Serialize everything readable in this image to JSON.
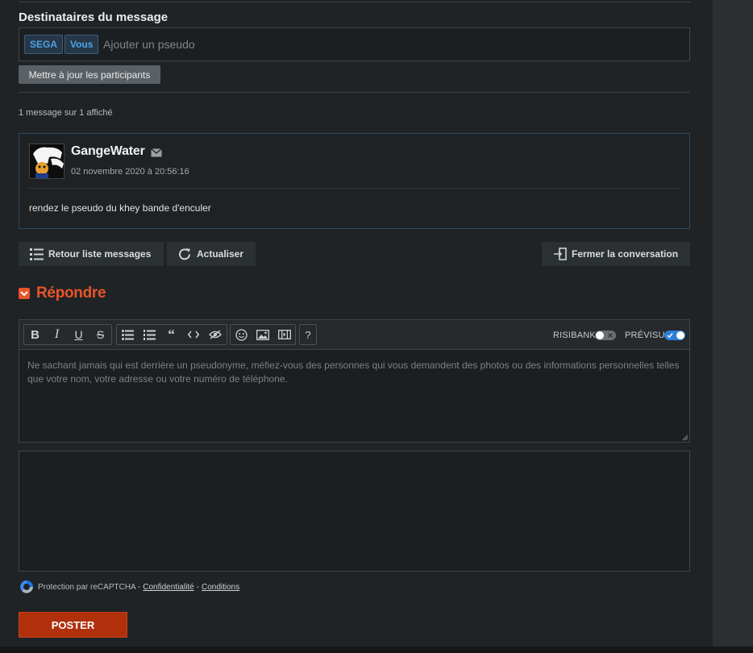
{
  "recipients": {
    "title": "Destinataires du message",
    "tags": [
      "SEGA",
      "Vous"
    ],
    "input_placeholder": "Ajouter un pseudo",
    "update_button": "Mettre à jour les participants"
  },
  "message_count": "1 message sur 1 affiché",
  "message": {
    "author": "GangeWater",
    "date": "02 novembre 2020 à 20:56:16",
    "body": "rendez le pseudo du khey bande d'enculer",
    "icons": [
      "avatar-image",
      "mail-icon"
    ]
  },
  "actions": {
    "back": "Retour liste messages",
    "refresh": "Actualiser",
    "close": "Fermer la conversation"
  },
  "reply": {
    "title": "Répondre",
    "toolbar": {
      "formatting": [
        "bold-icon",
        "italic-icon",
        "underline-icon",
        "strikethrough-icon"
      ],
      "blocks": [
        "bullet-list-icon",
        "numbered-list-icon",
        "quote-icon",
        "code-icon",
        "spoiler-icon"
      ],
      "media": [
        "smiley-icon",
        "image-icon",
        "video-icon"
      ],
      "help": "?"
    },
    "toggles": [
      {
        "label": "RISIBANK",
        "on": false
      },
      {
        "label": "PRÉVISU",
        "on": true
      }
    ],
    "placeholder": "Ne sachant jamais qui est derrière un pseudonyme, méfiez-vous des personnes qui vous demandent des photos ou des informations personnelles telles que votre nom, votre adresse ou votre numéro de téléphone."
  },
  "captcha": {
    "text": "Protection par reCAPTCHA -",
    "privacy": "Confidentialité",
    "sep": "-",
    "terms": "Conditions"
  },
  "submit": "POSTER",
  "colors": {
    "accent": "#e8542a",
    "submit_bg": "#b0300c",
    "tag_text": "#4fa3e8",
    "card_border": "#2c4763",
    "toggle_on": "#2b7fd8"
  }
}
